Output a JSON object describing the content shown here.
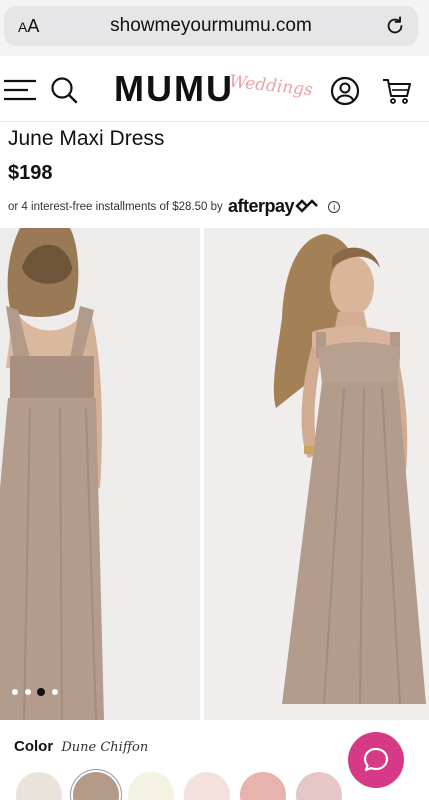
{
  "browser": {
    "aa_big": "A",
    "aa_small": "A",
    "url": "showmeyourmumu.com"
  },
  "header": {
    "logo_main": "MUMU",
    "logo_script": "Weddings"
  },
  "product": {
    "title": "June Maxi Dress",
    "price": "$198",
    "installments_text": "or 4 interest-free installments of $28.50 by",
    "afterpay_logo": "afterpay",
    "info_symbol": "i"
  },
  "gallery": {
    "total_images": 4,
    "active_index": 2
  },
  "color": {
    "label": "Color",
    "value": "Dune Chiffon",
    "swatches": [
      {
        "name": "light-beige",
        "hex": "#e9e3dc"
      },
      {
        "name": "dune",
        "hex": "#b49a88"
      },
      {
        "name": "ivory",
        "hex": "#f5f2e4"
      },
      {
        "name": "blush",
        "hex": "#f4e0dc"
      },
      {
        "name": "rose",
        "hex": "#e9b3ad"
      },
      {
        "name": "mauve",
        "hex": "#e6c7c7"
      }
    ],
    "selected_index": 1
  },
  "colors": {
    "dress": "#b49c8c",
    "chat": "#d63a86",
    "logo_script": "#e9a2a6"
  },
  "icons": [
    "reload-icon",
    "hamburger-icon",
    "search-icon",
    "account-icon",
    "cart-icon",
    "chat-icon",
    "info-icon"
  ]
}
